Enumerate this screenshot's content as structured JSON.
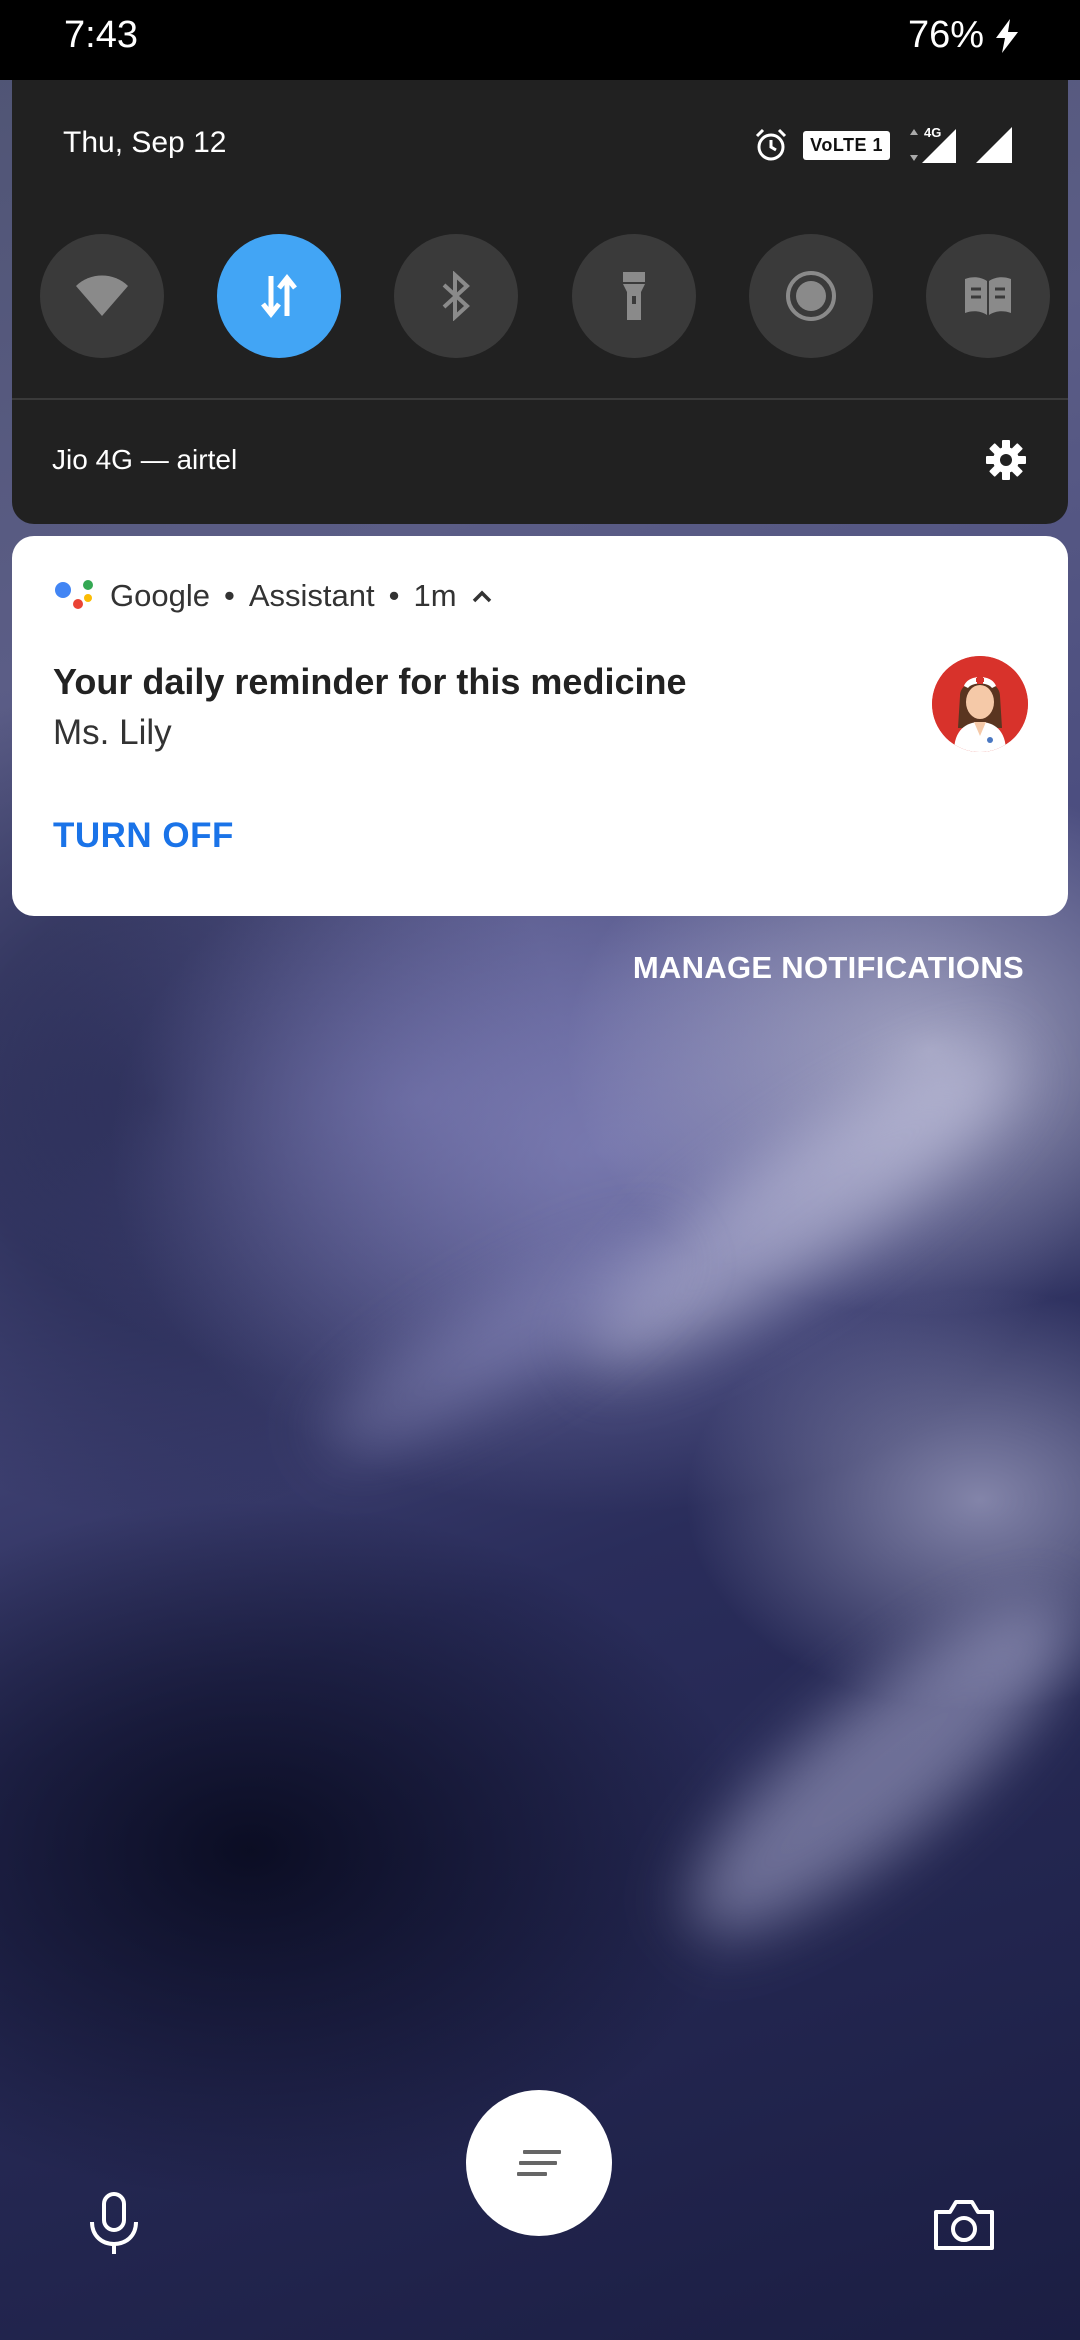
{
  "status_bar": {
    "time": "7:43",
    "battery": "76%",
    "charging_icon": "bolt-icon"
  },
  "quick_settings": {
    "date": "Thu, Sep 12",
    "status_icons": [
      "alarm-icon",
      "volte-badge",
      "4g-signal-icon",
      "signal-icon"
    ],
    "volte_label": "VoLTE 1",
    "network_label": "4G",
    "tiles": [
      {
        "name": "wifi",
        "icon": "wifi-icon",
        "active": false
      },
      {
        "name": "mobile-data",
        "icon": "data-arrows-icon",
        "active": true
      },
      {
        "name": "bluetooth",
        "icon": "bluetooth-icon",
        "active": false
      },
      {
        "name": "flashlight",
        "icon": "flashlight-icon",
        "active": false
      },
      {
        "name": "screen-record",
        "icon": "record-icon",
        "active": false
      },
      {
        "name": "reading-mode",
        "icon": "book-icon",
        "active": false
      }
    ],
    "carrier": "Jio 4G — airtel",
    "settings_icon": "gear-icon",
    "active_color": "#42a5f5"
  },
  "notification": {
    "app_name": "Google",
    "sub_app": "Assistant",
    "time": "1m",
    "separator": "•",
    "title": "Your daily reminder for this medicine",
    "text": "Ms. Lily",
    "action": "TURN OFF",
    "action_color": "#1a73e8",
    "avatar": "nurse-avatar-icon"
  },
  "manage_notifications": "MANAGE NOTIFICATIONS",
  "bottom": {
    "mic_icon": "microphone-icon",
    "assist_icon": "menu-lines-icon",
    "camera_icon": "camera-icon"
  }
}
